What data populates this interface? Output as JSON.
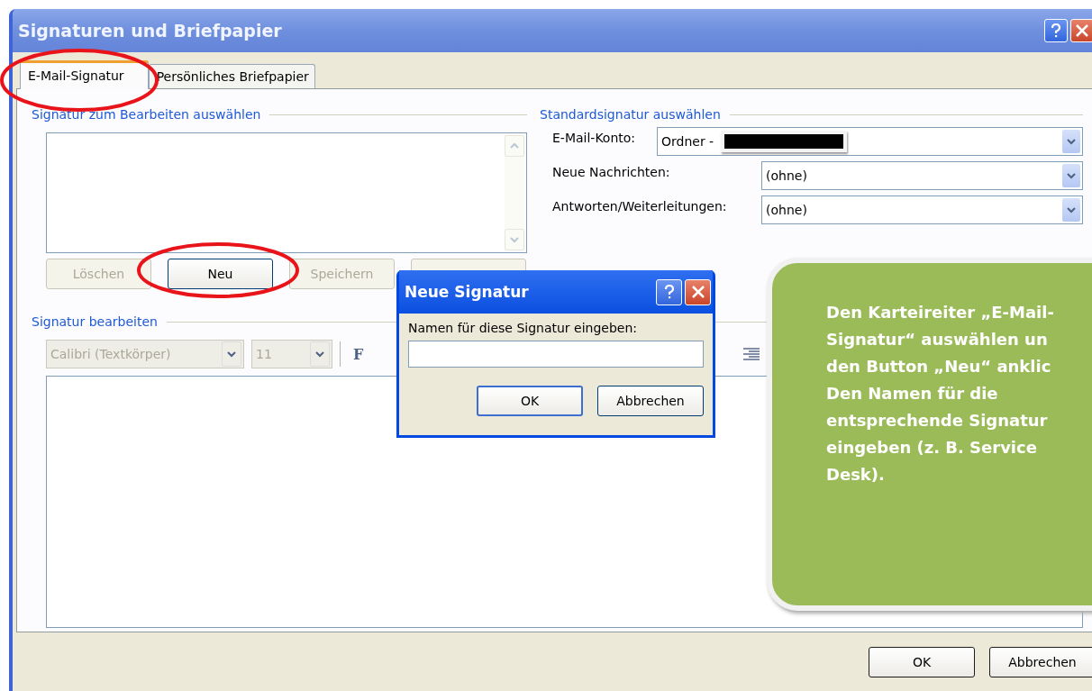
{
  "window": {
    "title": "Signaturen und Briefpapier"
  },
  "tabs": [
    {
      "label": "E-Mail-Signatur",
      "selected": true
    },
    {
      "label": "Persönliches Briefpapier",
      "selected": false
    }
  ],
  "select_section": {
    "heading": "Signatur zum Bearbeiten auswählen",
    "buttons": [
      {
        "label": "Löschen",
        "disabled": true
      },
      {
        "label": "Neu",
        "disabled": false
      },
      {
        "label": "Speichern",
        "disabled": true
      }
    ]
  },
  "default_section": {
    "heading": "Standardsignatur auswählen",
    "fields": [
      {
        "label": "E-Mail-Konto:",
        "value": "Ordner -",
        "redacted": true
      },
      {
        "label": "Neue Nachrichten:",
        "value": "(ohne)",
        "redacted": false
      },
      {
        "label": "Antworten/Weiterleitungen:",
        "value": "(ohne)",
        "redacted": false
      }
    ]
  },
  "edit_section": {
    "heading": "Signatur bearbeiten",
    "font": "Calibri (Textkörper)",
    "size": "11",
    "bold_key": "F"
  },
  "dialog": {
    "title": "Neue Signatur",
    "prompt": "Namen für diese Signatur eingeben:",
    "buttons": [
      "OK",
      "Abbrechen"
    ]
  },
  "callout": {
    "lines": [
      "Den Karteireiter „E-Mail-",
      "Signatur“ auswählen un",
      "den Button „Neu“ anklic",
      "Den Namen für die",
      "entsprechende Signatur",
      "eingeben (z. B. Service",
      "Desk)."
    ]
  },
  "footer_buttons": [
    "OK",
    "Abbrechen"
  ]
}
